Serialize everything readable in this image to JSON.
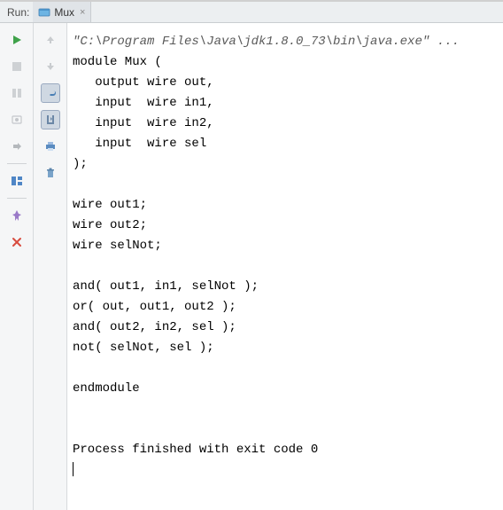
{
  "header": {
    "run_label": "Run:",
    "tab": {
      "name": "Mux",
      "close": "×"
    }
  },
  "console": {
    "command": "\"C:\\Program Files\\Java\\jdk1.8.0_73\\bin\\java.exe\" ...",
    "lines": [
      "module Mux (",
      "   output wire out,",
      "   input  wire in1,",
      "   input  wire in2,",
      "   input  wire sel",
      ");",
      "",
      "wire out1;",
      "wire out2;",
      "wire selNot;",
      "",
      "and( out1, in1, selNot );",
      "or( out, out1, out2 );",
      "and( out2, in2, sel );",
      "not( selNot, sel );",
      "",
      "endmodule",
      "",
      ""
    ],
    "exit_msg": "Process finished with exit code 0"
  }
}
